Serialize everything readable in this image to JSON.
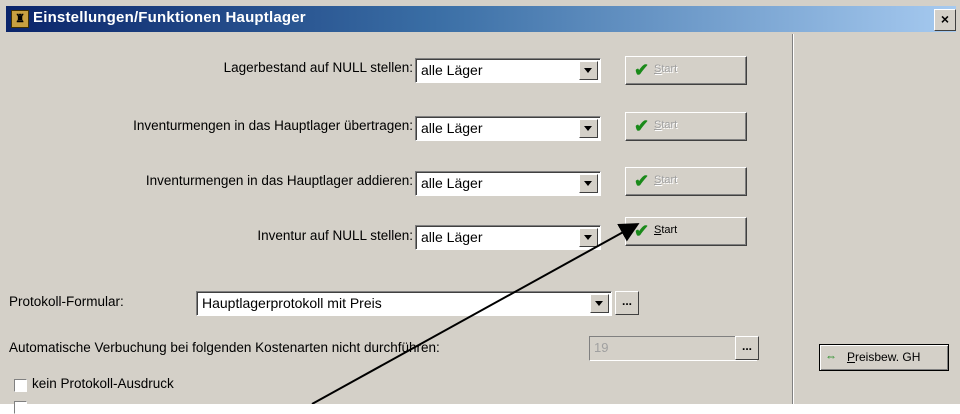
{
  "window": {
    "title": "Einstellungen/Funktionen Hauptlager",
    "close_label": "×"
  },
  "rows": [
    {
      "label": "Lagerbestand auf NULL stellen:",
      "combo_value": "alle Läger",
      "button_label": "Start",
      "button_accel": "S",
      "button_rest": "tart",
      "enabled": false
    },
    {
      "label": "Inventurmengen in das Hauptlager übertragen:",
      "combo_value": "alle Läger",
      "button_label": "Start",
      "button_accel": "S",
      "button_rest": "tart",
      "enabled": false
    },
    {
      "label": "Inventurmengen in das Hauptlager addieren:",
      "combo_value": "alle Läger",
      "button_label": "Start",
      "button_accel": "S",
      "button_rest": "tart",
      "enabled": false
    },
    {
      "label": "Inventur auf NULL stellen:",
      "combo_value": "alle Läger",
      "button_label": "Start",
      "button_accel": "S",
      "button_rest": "tart",
      "enabled": true
    }
  ],
  "protokoll": {
    "label": "Protokoll-Formular:",
    "value": "Hauptlagerprotokoll mit Preis",
    "browse_label": "..."
  },
  "kostenarten": {
    "label": "Automatische Verbuchung bei folgenden Kostenarten nicht durchführen:",
    "value": "19",
    "browse_label": "..."
  },
  "checkbox": {
    "label": "kein Protokoll-Ausdruck",
    "checked": false
  },
  "side_button": {
    "accel": "P",
    "rest": "reisbew. GH",
    "icon": "arrows-icon"
  },
  "colors": {
    "title_start": "#0a246a",
    "title_end": "#a6caf0",
    "face": "#d4d0c8",
    "check_green": "#1a8a1a"
  }
}
